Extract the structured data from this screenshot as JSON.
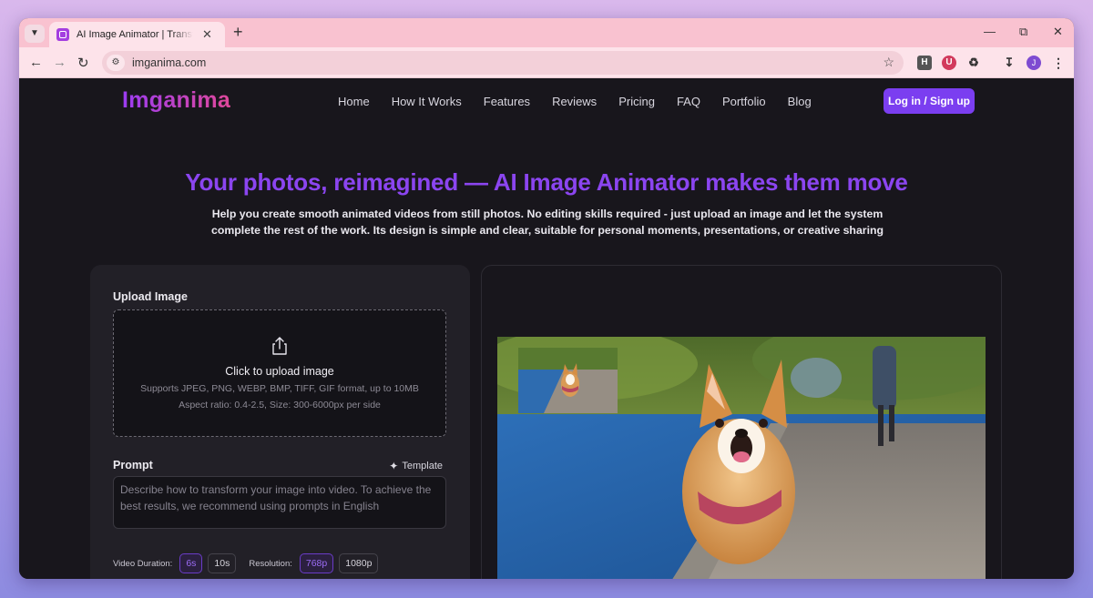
{
  "browser": {
    "tab_title": "AI Image Animator | Transform Images into Videos",
    "url": "imganima.com",
    "profile_initial": "J",
    "extensions": [
      "H",
      "U"
    ]
  },
  "site": {
    "logo": "Imganima",
    "nav": [
      "Home",
      "How It Works",
      "Features",
      "Reviews",
      "Pricing",
      "FAQ",
      "Portfolio",
      "Blog"
    ],
    "login_label": "Log in / Sign up"
  },
  "hero": {
    "title": "Your photos, reimagined — AI Image Animator makes them move",
    "subtitle": "Help you create smooth animated videos from still photos. No editing skills required - just upload an image and let the system complete the rest of the work. Its design is simple and clear, suitable for personal moments, presentations, or creative sharing"
  },
  "form": {
    "upload_label": "Upload Image",
    "upload_cta": "Click to upload image",
    "upload_hint_formats": "Supports JPEG, PNG, WEBP, BMP, TIFF, GIF format, up to 10MB",
    "upload_hint_size": "Aspect ratio: 0.4-2.5, Size: 300-6000px per side",
    "prompt_label": "Prompt",
    "template_label": "Template",
    "prompt_placeholder": "Describe how to transform your image into video. To achieve the best results, we recommend using prompts in English",
    "duration_label": "Video Duration:",
    "durations": [
      "6s",
      "10s"
    ],
    "selected_duration": "6s",
    "resolution_label": "Resolution:",
    "resolutions": [
      "768p",
      "1080p"
    ],
    "selected_resolution": "768p"
  },
  "colors": {
    "accent": "#7b3ef0",
    "title": "#8b45f0",
    "page_bg": "#18161c",
    "tabstrip": "#f9c2d0"
  }
}
